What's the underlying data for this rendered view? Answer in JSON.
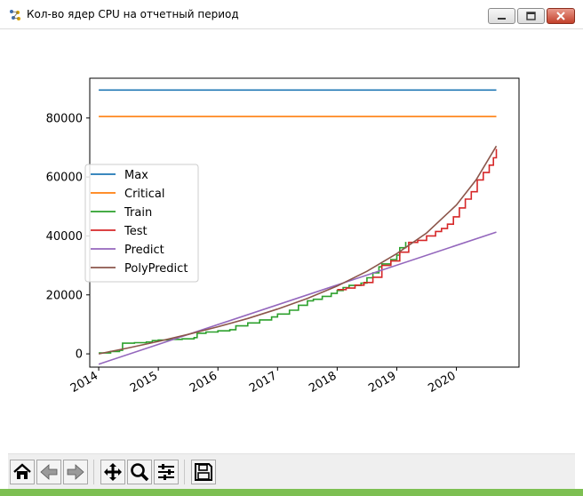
{
  "window": {
    "title": "Кол-во ядер CPU на отчетный период",
    "icons": {
      "app": "python-app-icon",
      "minimize": "minimize-icon",
      "maximize": "maximize-icon",
      "close": "close-icon"
    }
  },
  "chart_data": {
    "type": "line",
    "title": "",
    "xlabel": "",
    "ylabel": "",
    "x_ticks": [
      "2014",
      "2015",
      "2016",
      "2017",
      "2018",
      "2019",
      "2020"
    ],
    "y_ticks": [
      "0",
      "20000",
      "40000",
      "60000",
      "80000"
    ],
    "xlim": [
      2013.85,
      2021.05
    ],
    "ylim": [
      -4500,
      93500
    ],
    "legend_position": "center-left",
    "grid": false,
    "series": [
      {
        "name": "Max",
        "color": "#1f77b4",
        "x": [
          2014.0,
          2020.67
        ],
        "y": [
          89500,
          89500
        ]
      },
      {
        "name": "Critical",
        "color": "#ff7f0e",
        "x": [
          2014.0,
          2020.67
        ],
        "y": [
          80500,
          80500
        ]
      },
      {
        "name": "Train",
        "color": "#2ca02c",
        "x": [
          2014.0,
          2014.2,
          2014.35,
          2014.4,
          2014.6,
          2014.8,
          2014.9,
          2015.0,
          2015.2,
          2015.4,
          2015.6,
          2015.65,
          2015.8,
          2016.0,
          2016.2,
          2016.3,
          2016.5,
          2016.7,
          2016.9,
          2017.0,
          2017.2,
          2017.35,
          2017.5,
          2017.6,
          2017.75,
          2017.9,
          2018.0,
          2018.1,
          2018.2,
          2018.4,
          2018.5,
          2018.6,
          2018.7,
          2018.75,
          2018.9,
          2019.0,
          2019.05,
          2019.15
        ],
        "y": [
          300,
          800,
          1200,
          3600,
          3800,
          4000,
          4500,
          4700,
          4900,
          5100,
          5500,
          7000,
          7400,
          7800,
          8200,
          9500,
          10500,
          11500,
          12500,
          13500,
          14800,
          16500,
          18000,
          18500,
          19500,
          20500,
          21500,
          22500,
          23200,
          24000,
          25800,
          27500,
          29500,
          30500,
          32000,
          33500,
          36000,
          38000
        ]
      },
      {
        "name": "Test",
        "color": "#d62728",
        "x": [
          2018.0,
          2018.15,
          2018.3,
          2018.45,
          2018.6,
          2018.75,
          2018.9,
          2019.05,
          2019.2,
          2019.35,
          2019.5,
          2019.65,
          2019.75,
          2019.85,
          2019.95,
          2020.05,
          2020.15,
          2020.25,
          2020.35,
          2020.45,
          2020.55,
          2020.62,
          2020.67
        ],
        "y": [
          21800,
          22300,
          23300,
          24200,
          26000,
          30000,
          31500,
          34500,
          37800,
          38500,
          40000,
          41500,
          42500,
          44000,
          46500,
          49500,
          52500,
          55000,
          59000,
          61500,
          64000,
          66500,
          69500
        ]
      },
      {
        "name": "Predict",
        "color": "#9467bd",
        "x": [
          2014.0,
          2020.67
        ],
        "y": [
          -3500,
          41300
        ]
      },
      {
        "name": "PolyPredict",
        "color": "#8c564b",
        "x": [
          2014.0,
          2014.5,
          2015.0,
          2015.5,
          2016.0,
          2016.5,
          2017.0,
          2017.5,
          2018.0,
          2018.5,
          2019.0,
          2019.5,
          2020.0,
          2020.33,
          2020.67
        ],
        "y": [
          0,
          2000,
          4200,
          6600,
          9200,
          12000,
          15200,
          18800,
          23000,
          28000,
          34000,
          41000,
          50500,
          59000,
          70500
        ]
      }
    ]
  },
  "toolbar": {
    "buttons": [
      {
        "name": "home-button",
        "icon": "home-icon"
      },
      {
        "name": "back-button",
        "icon": "back-arrow-icon"
      },
      {
        "name": "forward-button",
        "icon": "forward-arrow-icon"
      },
      {
        "name": "pan-button",
        "icon": "pan-icon"
      },
      {
        "name": "zoom-button",
        "icon": "zoom-icon"
      },
      {
        "name": "configure-subplots-button",
        "icon": "sliders-icon"
      },
      {
        "name": "save-button",
        "icon": "save-icon"
      }
    ]
  }
}
